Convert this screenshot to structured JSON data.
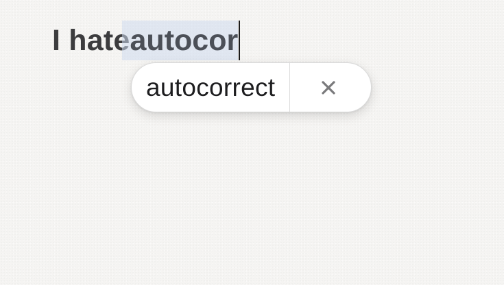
{
  "document": {
    "text_before": "I hate ",
    "marked_word": "autocor"
  },
  "autocorrect_popup": {
    "suggestion": "autocorrect",
    "dismiss_icon": "close-icon"
  },
  "colors": {
    "highlight": "#cddaee",
    "text": "#3c3c3e",
    "background": "#f5f4f2"
  }
}
